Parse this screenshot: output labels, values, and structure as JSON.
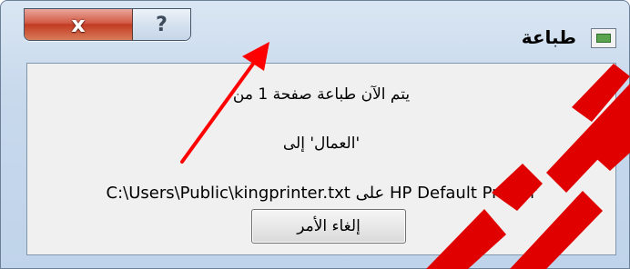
{
  "window": {
    "title": "طباعة",
    "close_glyph": "x",
    "help_glyph": "?"
  },
  "message": {
    "line1": "يتم الآن طباعة صفحة 1 من",
    "line2": "'العمال' إلى",
    "line3": "C:\\Users\\Public\\kingprinter.txt على HP Default Printer"
  },
  "buttons": {
    "cancel_label": "إلغاء الأمر"
  },
  "icons": {
    "close": "close-icon",
    "help": "help-icon",
    "app": "printer-app-icon"
  },
  "colors": {
    "annotation_arrow": "#ff0000",
    "watermark": "#e00000"
  }
}
